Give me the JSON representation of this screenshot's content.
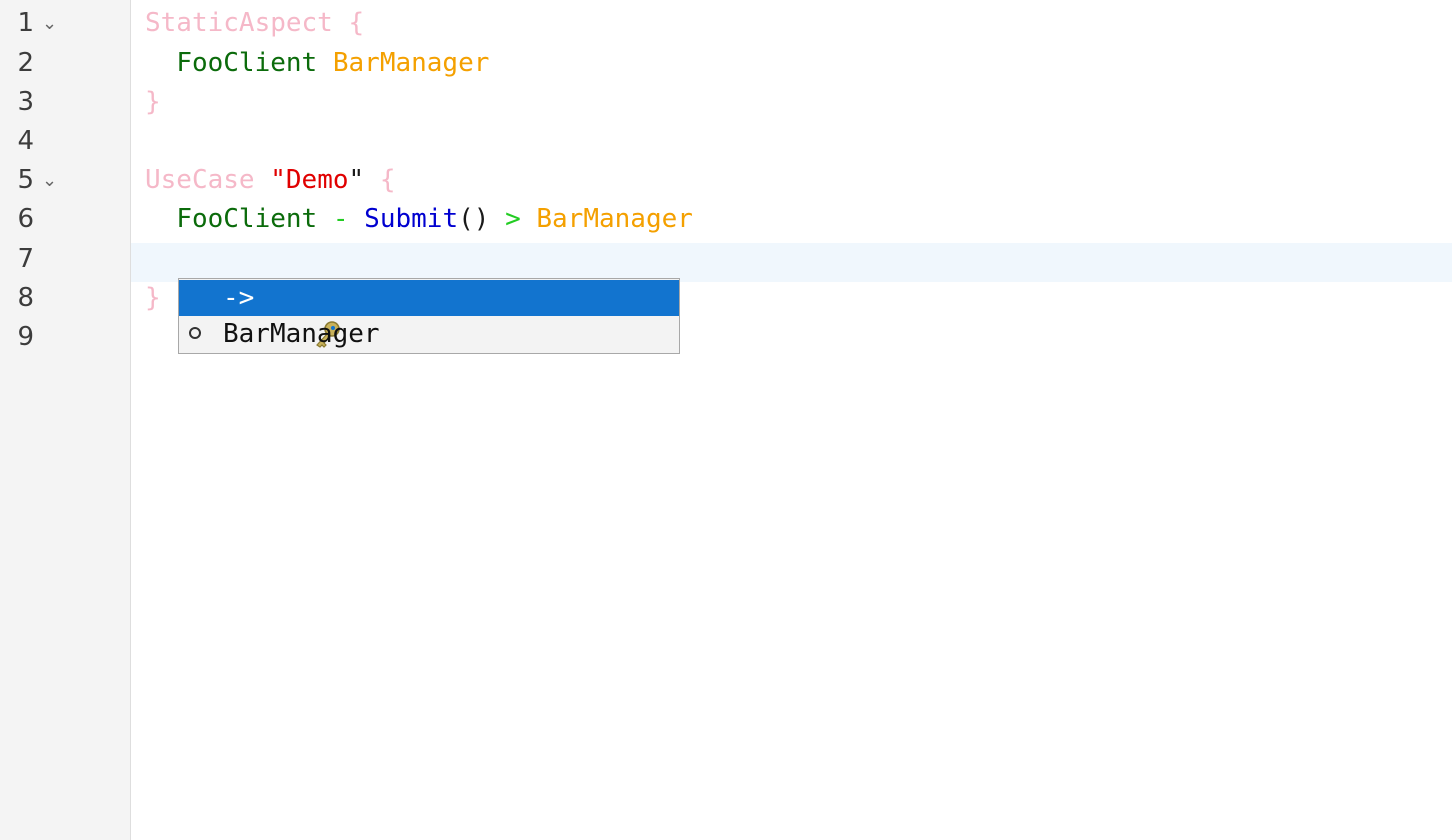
{
  "gutter": {
    "lines": [
      {
        "number": "1",
        "fold": "⌄"
      },
      {
        "number": "2",
        "fold": ""
      },
      {
        "number": "3",
        "fold": ""
      },
      {
        "number": "4",
        "fold": ""
      },
      {
        "number": "5",
        "fold": "⌄"
      },
      {
        "number": "6",
        "fold": ""
      },
      {
        "number": "7",
        "fold": ""
      },
      {
        "number": "8",
        "fold": ""
      },
      {
        "number": "9",
        "fold": ""
      }
    ]
  },
  "code": {
    "line1": {
      "keyword": "StaticAspect",
      "brace": "{"
    },
    "line2": {
      "client": "FooClient",
      "manager": "BarManager"
    },
    "line3": {
      "brace": "}"
    },
    "line5": {
      "keyword": "UseCase",
      "quote_open": "\"",
      "name": "Demo",
      "quote_close": "\"",
      "brace": "{"
    },
    "line6": {
      "client": "FooClient",
      "dash": "-",
      "method": "Submit",
      "parens": "()",
      "arrow": ">",
      "manager": "BarManager"
    },
    "line8": {
      "brace": "}"
    }
  },
  "autocomplete": {
    "items": [
      {
        "label": "->",
        "icon": "key-icon",
        "selected": true
      },
      {
        "label": "BarManager",
        "icon": "circle-icon",
        "selected": false
      }
    ]
  },
  "colors": {
    "keyword": "#f5b8c8",
    "identifier_green": "#0b6b0b",
    "identifier_orange": "#f4a000",
    "string": "#e00000",
    "method": "#0000d0",
    "arrow": "#22cc22",
    "selection": "#1274cf",
    "current_line": "#f0f7fd"
  }
}
